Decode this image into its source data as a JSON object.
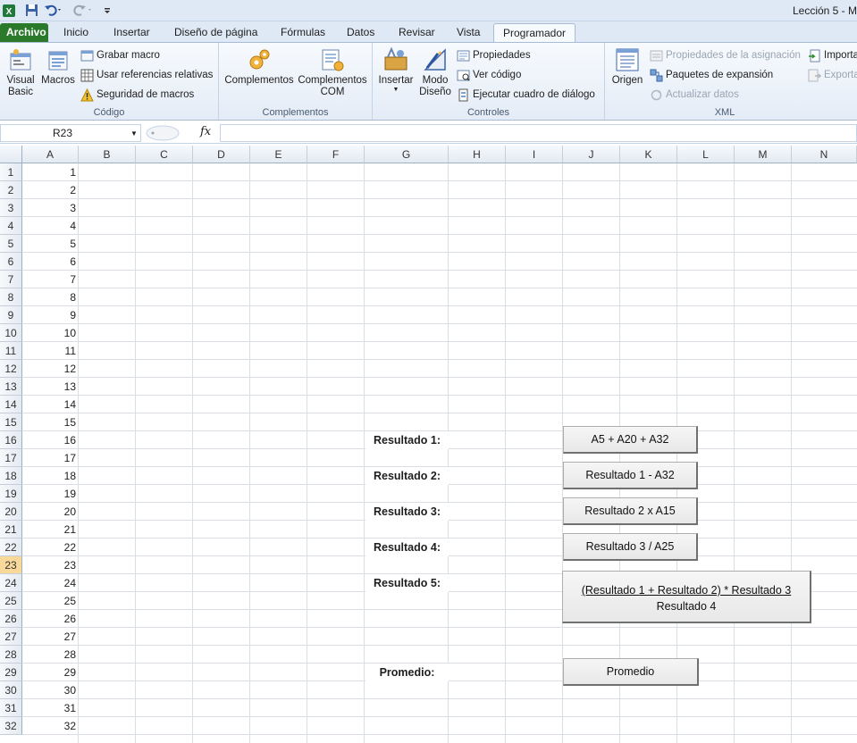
{
  "window": {
    "title": "Lección 5 - M"
  },
  "quick_access": {
    "icons": [
      "excel-icon",
      "save-icon",
      "undo-icon",
      "redo-icon",
      "customize-icon"
    ]
  },
  "tabs": [
    "Archivo",
    "Inicio",
    "Insertar",
    "Diseño de página",
    "Fórmulas",
    "Datos",
    "Revisar",
    "Vista",
    "Programador"
  ],
  "active_tab": "Programador",
  "ribbon": {
    "codigo": {
      "label": "Código",
      "visual_basic": "Visual Basic",
      "macros": "Macros",
      "grabar_macro": "Grabar macro",
      "usar_referencias": "Usar referencias relativas",
      "seguridad": "Seguridad de macros"
    },
    "complementos": {
      "label": "Complementos",
      "complementos": "Complementos",
      "complementos_com": "Complementos COM"
    },
    "controles": {
      "label": "Controles",
      "insertar": "Insertar",
      "modo_diseno": "Modo Diseño",
      "propiedades": "Propiedades",
      "ver_codigo": "Ver código",
      "ejecutar": "Ejecutar cuadro de diálogo"
    },
    "xml": {
      "label": "XML",
      "origen": "Origen",
      "propiedades_asignacion": "Propiedades de la asignación",
      "paquetes": "Paquetes de expansión",
      "actualizar": "Actualizar datos",
      "importar": "Importar",
      "exportar": "Exportar"
    }
  },
  "formula_bar": {
    "name_box": "R23",
    "fx": "fx",
    "formula": ""
  },
  "columns": [
    "A",
    "B",
    "C",
    "D",
    "E",
    "F",
    "G",
    "H",
    "I",
    "J",
    "K",
    "L",
    "M",
    "N"
  ],
  "rows": [
    "1",
    "2",
    "3",
    "4",
    "5",
    "6",
    "7",
    "8",
    "9",
    "10",
    "11",
    "12",
    "13",
    "14",
    "15",
    "16",
    "17",
    "18",
    "19",
    "20",
    "21",
    "22",
    "23",
    "24",
    "25",
    "26",
    "27",
    "28",
    "29",
    "30",
    "31",
    "32"
  ],
  "selected_row": "23",
  "column_a_values": [
    "1",
    "2",
    "3",
    "4",
    "5",
    "6",
    "7",
    "8",
    "9",
    "10",
    "11",
    "12",
    "13",
    "14",
    "15",
    "16",
    "17",
    "18",
    "19",
    "20",
    "21",
    "22",
    "23",
    "24",
    "25",
    "26",
    "27",
    "28",
    "29",
    "30",
    "31",
    "32"
  ],
  "labels": {
    "r1": "Resultado 1:",
    "r2": "Resultado 2:",
    "r3": "Resultado 3:",
    "r4": "Resultado 4:",
    "r5": "Resultado 5:",
    "promedio": "Promedio:"
  },
  "buttons": {
    "b1": "A5 + A20 + A32",
    "b2": "Resultado 1 - A32",
    "b3": "Resultado 2 x A15",
    "b4": "Resultado 3 / A25",
    "b5_line1": "(Resultado 1 + Resultado 2) * Resultado 3",
    "b5_line2": "Resultado 4",
    "promedio": "Promedio"
  }
}
